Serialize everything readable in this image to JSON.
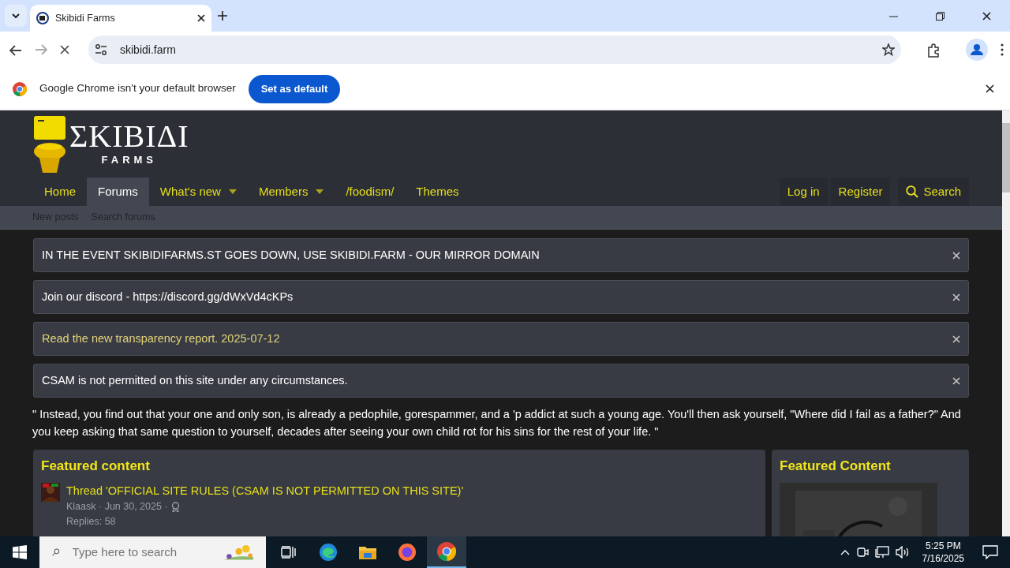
{
  "browser": {
    "tab_title": "Skibidi Farms",
    "address": "skibidi.farm",
    "loading": true,
    "infobar": {
      "message": "Google Chrome isn't your default browser",
      "button": "Set as default"
    }
  },
  "site": {
    "logo": {
      "main": "ΣΚΙΒΙΔΙ",
      "sub": "FARMS"
    },
    "nav": [
      {
        "label": "Home",
        "selected": false,
        "dropdown": false
      },
      {
        "label": "Forums",
        "selected": true,
        "dropdown": false
      },
      {
        "label": "What's new",
        "selected": false,
        "dropdown": true
      },
      {
        "label": "Members",
        "selected": false,
        "dropdown": true
      },
      {
        "label": "/foodism/",
        "selected": false,
        "dropdown": false
      },
      {
        "label": "Themes",
        "selected": false,
        "dropdown": false
      }
    ],
    "nav_right": [
      {
        "label": "Log in",
        "kind": "link"
      },
      {
        "label": "Register",
        "kind": "link"
      },
      {
        "label": "Search",
        "kind": "search"
      }
    ],
    "subnav": [
      "New posts",
      "Search forums"
    ],
    "notices": [
      {
        "text": "IN THE EVENT SKIBIDIFARMS.ST GOES DOWN, USE SKIBIDI.FARM - OUR MIRROR DOMAIN",
        "kind": "plain"
      },
      {
        "text": "Join our discord - https://discord.gg/dWxVd4cKPs",
        "kind": "plain"
      },
      {
        "text": "Read the new transparency report. 2025-07-12",
        "kind": "link"
      },
      {
        "text": "CSAM is not permitted on this site under any circumstances.",
        "kind": "plain"
      }
    ],
    "quote": "\" Instead, you find out that your one and only son, is already a pedophile, gorespammer, and a 'p addict at such a young age. You'll then ask yourself, \"Where did I fail as a father?\" And you keep asking that same question to yourself, decades after seeing your own child rot for his sins for the rest of your life. \"",
    "featured": {
      "title": "Featured content",
      "items": [
        {
          "title": "Thread 'OFFICIAL SITE RULES (CSAM IS NOT PERMITTED ON THIS SITE)'",
          "meta": "Klaask · Jun 30, 2025 ·",
          "replies": "Replies: 58"
        }
      ]
    },
    "sidebar": {
      "title": "Featured Content"
    }
  },
  "taskbar": {
    "search_placeholder": "Type here to search",
    "time": "5:25 PM",
    "date": "7/16/2025"
  }
}
